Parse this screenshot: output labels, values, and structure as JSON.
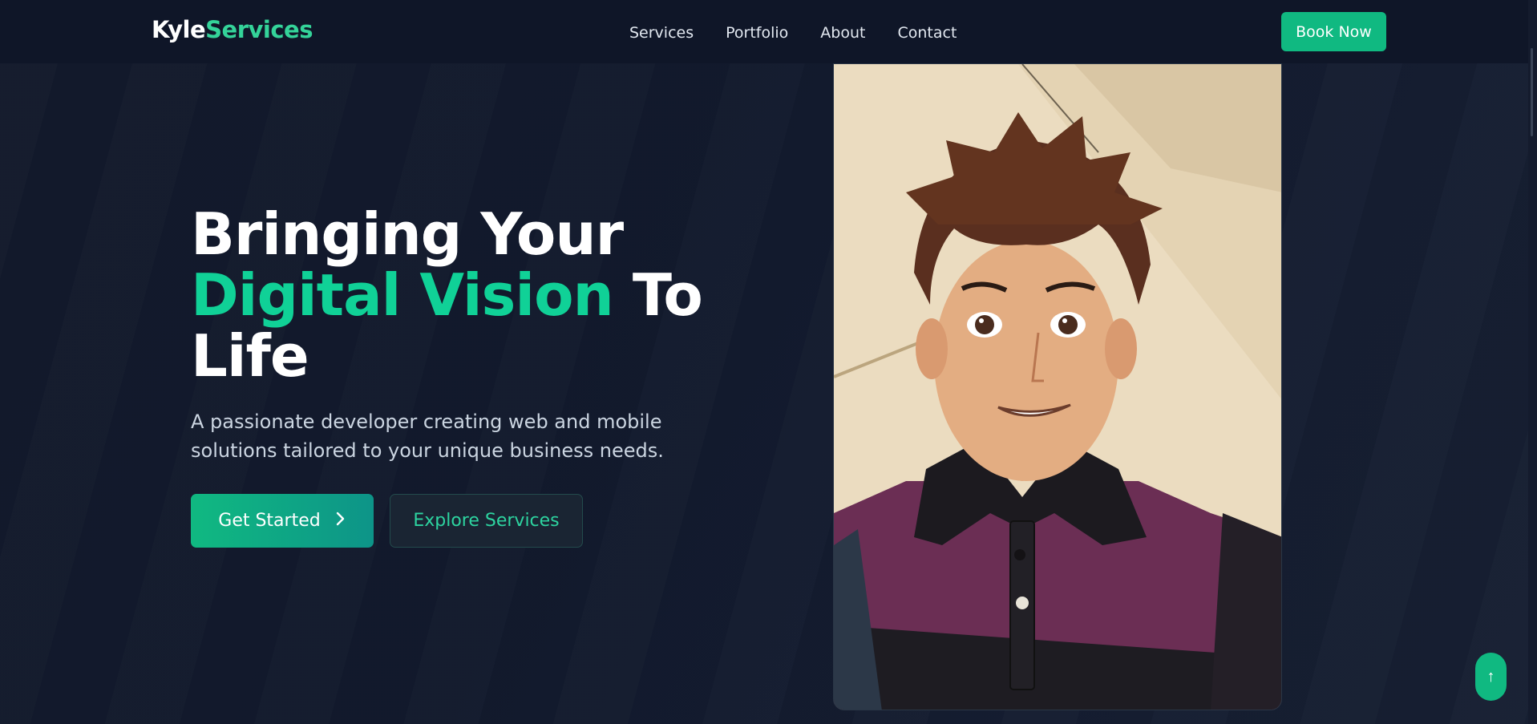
{
  "brand": {
    "part1": "Kyle",
    "part2": "Services"
  },
  "nav": {
    "items": [
      "Services",
      "Portfolio",
      "About",
      "Contact"
    ]
  },
  "header": {
    "cta_label": "Book Now"
  },
  "hero": {
    "title_line1": "Bringing Your",
    "title_accent": "Digital Vision",
    "title_line2_rest": " To",
    "title_line3": "Life",
    "subtitle": "A passionate developer creating web and mobile solutions tailored to your unique business needs.",
    "primary_button": "Get Started",
    "secondary_button": "Explore Services"
  },
  "scroll_top": {
    "icon": "arrow-up-icon",
    "glyph": "↑"
  },
  "colors": {
    "accent": "#10b981",
    "accent_text": "#10d197",
    "background": "#131a2c",
    "header_bg": "#0f1628"
  }
}
